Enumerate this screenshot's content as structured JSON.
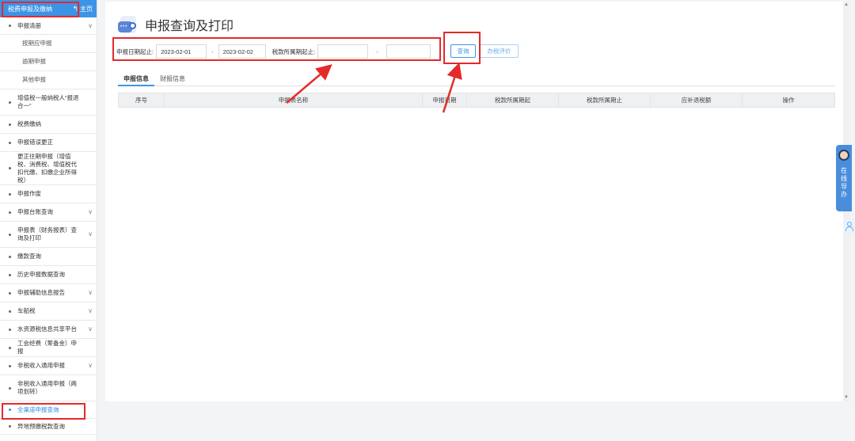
{
  "sidebar": {
    "header_title": "税费申报及缴纳",
    "home_label": "主页",
    "items": [
      {
        "label": "申报清册",
        "type": "group",
        "expand": true
      },
      {
        "label": "按期应申报",
        "type": "sub"
      },
      {
        "label": "逾期申报",
        "type": "sub"
      },
      {
        "label": "其他申报",
        "type": "sub"
      },
      {
        "label": "增值税一般纳税人“报退合一”",
        "type": "group"
      },
      {
        "label": "税费缴纳",
        "type": "group"
      },
      {
        "label": "申报错误更正",
        "type": "group"
      },
      {
        "label": "更正往期申报（增值税、消费税、增值税代扣代缴、扣缴企业所得税）",
        "type": "group"
      },
      {
        "label": "申报作废",
        "type": "group"
      },
      {
        "label": "申报台账查询",
        "type": "group",
        "expand": true
      },
      {
        "label": "申报表（财务报表）查询及打印",
        "type": "group",
        "expand": true
      },
      {
        "label": "缴款查询",
        "type": "group"
      },
      {
        "label": "历史申报数据查询",
        "type": "group"
      },
      {
        "label": "申报辅助信息报告",
        "type": "group",
        "expand": true
      },
      {
        "label": "车船税",
        "type": "group",
        "expand": true
      },
      {
        "label": "水资源税信息共享平台",
        "type": "group",
        "expand": true
      },
      {
        "label": "工会经费（筹备金）申报",
        "type": "group"
      },
      {
        "label": "非税收入通用申报",
        "type": "group",
        "expand": true
      },
      {
        "label": "非税收入通用申报（两项划转）",
        "type": "group"
      },
      {
        "label": "全渠道申报查询",
        "type": "group",
        "active": true
      },
      {
        "label": "异地预缴税款查询",
        "type": "group"
      }
    ]
  },
  "main": {
    "title": "申报查询及打印",
    "filter": {
      "date_label": "申报日期起止:",
      "date_start": "2023-02-01",
      "date_end": "2023-02-02",
      "period_label": "税款所属期起止:",
      "period_start": "",
      "period_end": "",
      "separator": "-"
    },
    "buttons": {
      "query": "查询",
      "evaluate": "办税评价"
    },
    "tabs": [
      {
        "label": "申报信息",
        "active": true
      },
      {
        "label": "财报信息",
        "active": false
      }
    ],
    "table_headers": [
      "序号",
      "申报表名称",
      "申报日期",
      "税款所属期起",
      "税款所属期止",
      "应补退税额",
      "操作"
    ]
  },
  "float": {
    "help_text": "在线导办"
  },
  "colors": {
    "accent": "#3b94e6",
    "annotation": "#e42a2a"
  }
}
